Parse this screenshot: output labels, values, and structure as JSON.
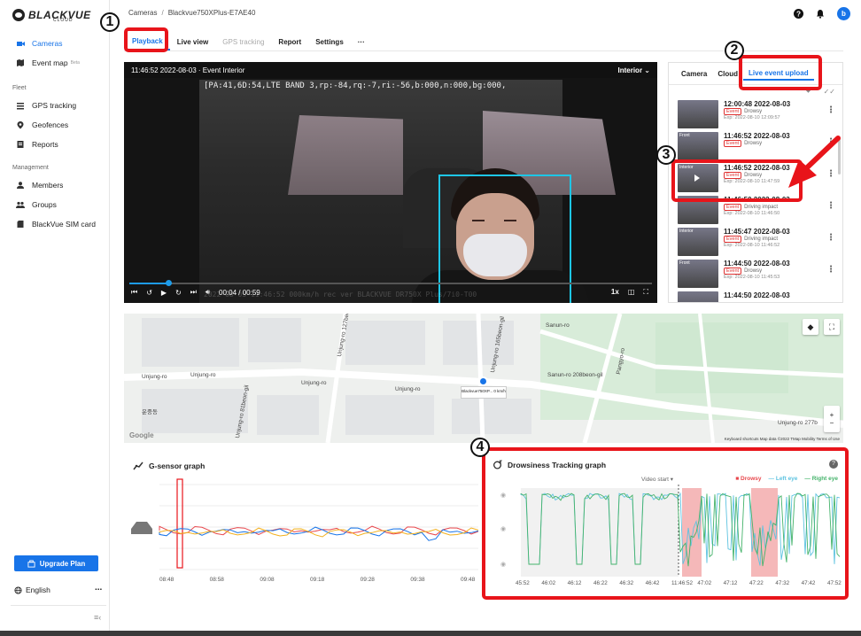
{
  "brand": {
    "name": "BLACKVUE",
    "sub": "CLOUD"
  },
  "sidebar": {
    "items": [
      {
        "label": "Cameras",
        "icon": "camera-icon",
        "active": true
      },
      {
        "label": "Event map",
        "badge": "Beta",
        "icon": "map-icon"
      }
    ],
    "fleet_heading": "Fleet",
    "fleet_items": [
      {
        "label": "GPS tracking",
        "icon": "gps-icon"
      },
      {
        "label": "Geofences",
        "icon": "location-pin-icon"
      },
      {
        "label": "Reports",
        "icon": "report-icon"
      }
    ],
    "management_heading": "Management",
    "management_items": [
      {
        "label": "Members",
        "icon": "member-icon"
      },
      {
        "label": "Groups",
        "icon": "group-icon"
      },
      {
        "label": "BlackVue SIM card",
        "icon": "sim-card-icon"
      }
    ],
    "upgrade_label": "Upgrade Plan",
    "language": "English",
    "more": "..."
  },
  "header": {
    "breadcrumb": [
      "Cameras",
      "Blackvue750XPlus-E7AE40"
    ],
    "avatar": "b"
  },
  "tabs": [
    {
      "label": "Playback",
      "active": true
    },
    {
      "label": "Live view"
    },
    {
      "label": "GPS tracking",
      "disabled": true
    },
    {
      "label": "Report"
    },
    {
      "label": "Settings"
    },
    {
      "label": "···"
    }
  ],
  "video": {
    "title": "11:46:52 2022-08-03 · Event Interior",
    "view": "Interior",
    "overlay": "[PA:41,6D:54,LTE BAND 3,rp:-84,rq:-7,ri:-56,b:000,n:000,bg:000,",
    "watermark": "2022 08 03 11:46:52 000km/h   rec ver BLACKVUE DR750X Plus/7i0-T00",
    "time": "00:04 / 00:59",
    "speed": "1x",
    "progress": 0.075
  },
  "panel": {
    "tabs": [
      {
        "label": "Camera"
      },
      {
        "label": "Cloud"
      },
      {
        "label": "Live event upload",
        "active": true
      }
    ],
    "items": [
      {
        "time": "12:00:48 2022-08-03",
        "tag": "Event",
        "type": "Drowsy",
        "exp": "Exp: 2022-08-10 12:09:57",
        "thumb": ""
      },
      {
        "time": "11:46:52 2022-08-03",
        "tag": "Event",
        "type": "Drowsy",
        "exp": "",
        "thumb": "Front"
      },
      {
        "time": "11:46:52 2022-08-03",
        "tag": "Event",
        "type": "Drowsy",
        "exp": "Exp: 2022-08-10 11:47:59",
        "thumb": "Interior"
      },
      {
        "time": "11:46:50 2022-08-03",
        "tag": "Event",
        "type": "Driving impact",
        "exp": "Exp: 2022-08-10 11:46:50",
        "thumb": ""
      },
      {
        "time": "11:45:47 2022-08-03",
        "tag": "Event",
        "type": "Driving impact",
        "exp": "Exp: 2022-08-10 11:46:52",
        "thumb": "Interior"
      },
      {
        "time": "11:44:50 2022-08-03",
        "tag": "Event",
        "type": "Drowsy",
        "exp": "Exp: 2022-08-10 11:45:53",
        "thumb": "Front"
      },
      {
        "time": "11:44:50 2022-08-03",
        "tag": "",
        "type": "",
        "exp": "",
        "thumb": ""
      }
    ]
  },
  "map": {
    "labels": [
      "Unjung-ro",
      "Unjung-ro",
      "Unjung-ro",
      "Unjung-ro",
      "Unjung-ro 127beon-gil",
      "Unjung-ro 81beon-gil",
      "Unjung-ro 165beon-gil",
      "Sanun-ro",
      "Sanun-ro 208beon-gil",
      "Pangyo-ro",
      "Unjung-ro 277b",
      "운중동"
    ],
    "car_label": "Blackvue750XP... 0 km/h",
    "footer": "Keyboard shortcuts   Map data ©2022 TMap Mobility   Terms of Use",
    "google": "Google"
  },
  "gsensor": {
    "title": "G-sensor graph",
    "ticks": [
      "08:48",
      "08:58",
      "09:08",
      "09:18",
      "09:28",
      "09:38",
      "09:48"
    ]
  },
  "drowsy": {
    "title": "Drowsiness Tracking graph",
    "video_start": "Video start",
    "legend": [
      {
        "label": "Drowsy",
        "color": "#e8474c"
      },
      {
        "label": "Left eye",
        "color": "#5ec3e0"
      },
      {
        "label": "Right eye",
        "color": "#45b36b"
      }
    ],
    "ticks": [
      "45:52",
      "46:02",
      "46:12",
      "46:22",
      "46:32",
      "46:42",
      "11:46:52",
      "47:02",
      "47:12",
      "47:22",
      "47:32",
      "47:42",
      "47:52"
    ]
  },
  "callouts": [
    "1",
    "2",
    "3",
    "4"
  ],
  "colors": {
    "accent": "#1874e8",
    "annotation": "#e8141a"
  }
}
